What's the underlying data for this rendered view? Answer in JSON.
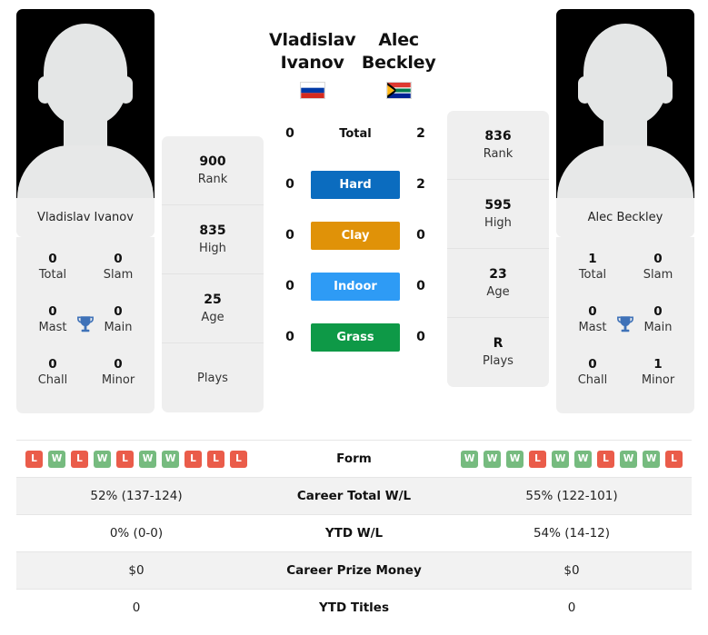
{
  "players": {
    "left": {
      "first_name": "Vladislav",
      "last_name": "Ivanov",
      "full_name": "Vladislav Ivanov",
      "flag": "russia-flag",
      "rank": "900",
      "rank_label": "Rank",
      "high": "835",
      "high_label": "High",
      "age": "25",
      "age_label": "Age",
      "plays": "",
      "plays_label": "Plays",
      "titles": {
        "total": "0",
        "total_label": "Total",
        "slam": "0",
        "slam_label": "Slam",
        "mast": "0",
        "mast_label": "Mast",
        "main": "0",
        "main_label": "Main",
        "chall": "0",
        "chall_label": "Chall",
        "minor": "0",
        "minor_label": "Minor"
      },
      "form": [
        "L",
        "W",
        "L",
        "W",
        "L",
        "W",
        "W",
        "L",
        "L",
        "L"
      ],
      "career_wl": "52% (137-124)",
      "ytd_wl": "0% (0-0)",
      "career_prize": "$0",
      "ytd_titles": "0"
    },
    "right": {
      "first_name": "Alec",
      "last_name": "Beckley",
      "full_name": "Alec Beckley",
      "flag": "south-africa-flag",
      "rank": "836",
      "rank_label": "Rank",
      "high": "595",
      "high_label": "High",
      "age": "23",
      "age_label": "Age",
      "plays": "R",
      "plays_label": "Plays",
      "titles": {
        "total": "1",
        "total_label": "Total",
        "slam": "0",
        "slam_label": "Slam",
        "mast": "0",
        "mast_label": "Mast",
        "main": "0",
        "main_label": "Main",
        "chall": "0",
        "chall_label": "Chall",
        "minor": "1",
        "minor_label": "Minor"
      },
      "form": [
        "W",
        "W",
        "W",
        "L",
        "W",
        "W",
        "L",
        "W",
        "W",
        "L"
      ],
      "career_wl": "55% (122-101)",
      "ytd_wl": "54% (14-12)",
      "career_prize": "$0",
      "ytd_titles": "0"
    }
  },
  "head_to_head": [
    {
      "label": "Total",
      "left": "0",
      "right": "2",
      "color": "",
      "pill": false
    },
    {
      "label": "Hard",
      "left": "0",
      "right": "2",
      "color": "#0b6cbf",
      "pill": true
    },
    {
      "label": "Clay",
      "left": "0",
      "right": "0",
      "color": "#e09208",
      "pill": true
    },
    {
      "label": "Indoor",
      "left": "0",
      "right": "0",
      "color": "#2e9bf5",
      "pill": true
    },
    {
      "label": "Grass",
      "left": "0",
      "right": "0",
      "color": "#0e9947",
      "pill": true
    }
  ],
  "table": {
    "rows": [
      {
        "label": "Form",
        "type": "form"
      },
      {
        "label": "Career Total W/L",
        "type": "text",
        "key": "career_wl"
      },
      {
        "label": "YTD W/L",
        "type": "text",
        "key": "ytd_wl"
      },
      {
        "label": "Career Prize Money",
        "type": "text",
        "key": "career_prize"
      },
      {
        "label": "YTD Titles",
        "type": "text",
        "key": "ytd_titles"
      }
    ]
  },
  "colors": {
    "win": "#76bb7f",
    "loss": "#ea5c4a",
    "hard": "#0b6cbf",
    "clay": "#e09208",
    "indoor": "#2e9bf5",
    "grass": "#0e9947",
    "card_bg": "#efefef",
    "trophy": "#3f72b8"
  }
}
